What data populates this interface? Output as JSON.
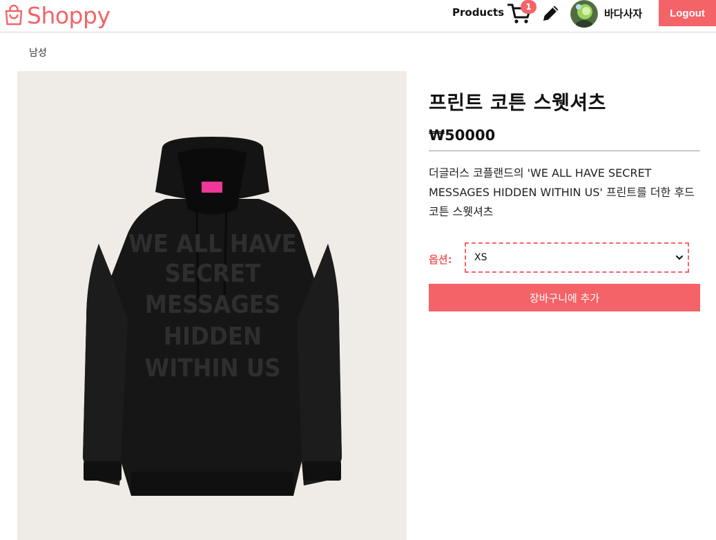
{
  "brand": {
    "name": "Shoppy",
    "color": "#f46367",
    "icon": "shopping-bag-icon"
  },
  "nav": {
    "products_label": "Products",
    "cart_count": "1",
    "cart_icon": "cart-icon",
    "edit_icon": "pencil-icon",
    "user_name": "바다사자",
    "logout_label": "Logout"
  },
  "product": {
    "category": "남성",
    "title": "프린트 코튼 스웻셔츠",
    "price": "₩50000",
    "description": "더글러스 코플랜드의 'WE ALL HAVE SECRET MESSAGES HIDDEN WITHIN US' 프린트를 더한 후드 코튼 스웻셔츠",
    "image_print_text": [
      "WE ALL HAVE",
      "SECRET",
      "MESSAGES",
      "HIDDEN",
      "WITHIN US"
    ]
  },
  "options": {
    "label": "옵션:",
    "selected": "XS"
  },
  "add_to_cart_label": "장바구니에 추가"
}
